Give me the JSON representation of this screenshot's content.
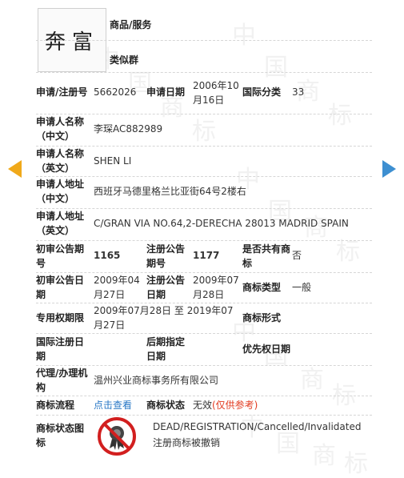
{
  "watermark": [
    "中",
    "国",
    "商",
    "标",
    "中",
    "国",
    "商",
    "标",
    "中",
    "国",
    "商",
    "标",
    "中",
    "国",
    "商",
    "标",
    "中",
    "国",
    "商",
    "标"
  ],
  "trademark": {
    "image_text": "奔富"
  },
  "rows": {
    "goods_label": "商品/服务",
    "similar_label": "类似群",
    "reg_no_label": "申请/注册号",
    "reg_no": "5662026",
    "app_date_label": "申请日期",
    "app_date": "2006年10月16日",
    "intl_class_label": "国际分类",
    "intl_class": "33",
    "applicant_cn_label": "申请人名称（中文）",
    "applicant_cn": "李琛AC882989",
    "applicant_en_label": "申请人名称（英文）",
    "applicant_en": "SHEN LI",
    "address_cn_label": "申请人地址（中文）",
    "address_cn": "西班牙马德里格兰比亚街64号2楼右",
    "address_en_label": "申请人地址（英文）",
    "address_en": "C/GRAN VIA NO.64,2-DERECHA 28013 MADRID SPAIN",
    "prelim_no_label": "初审公告期号",
    "prelim_no": "1165",
    "reg_pub_no_label": "注册公告期号",
    "reg_pub_no": "1177",
    "shared_label": "是否共有商标",
    "shared": "否",
    "prelim_date_label": "初审公告日期",
    "prelim_date": "2009年04月27日",
    "reg_pub_date_label": "注册公告日期",
    "reg_pub_date": "2009年07月28日",
    "tm_type_label": "商标类型",
    "tm_type": "一般",
    "exclusive_label": "专用权期限",
    "exclusive": "2009年07月28日 至 2019年07月27日",
    "tm_form_label": "商标形式",
    "intl_reg_date_label": "国际注册日期",
    "later_date_label": "后期指定日期",
    "priority_date_label": "优先权日期",
    "agent_label": "代理/办理机构",
    "agent": "温州兴业商标事务所有限公司",
    "process_label": "商标流程",
    "process_link": "点击查看",
    "status_label": "商标状态",
    "status_value": "无效",
    "status_note": "(仅供参考)",
    "status_icon_label": "商标状态图标",
    "status_en": "DEAD/REGISTRATION/Cancelled/Invalidated",
    "status_cn": "注册商标被撤销"
  },
  "colors": {
    "prev_arrow": "#f0a91a",
    "next_arrow": "#3d8fd1",
    "link": "#2a78c6",
    "note": "#e23b20"
  }
}
